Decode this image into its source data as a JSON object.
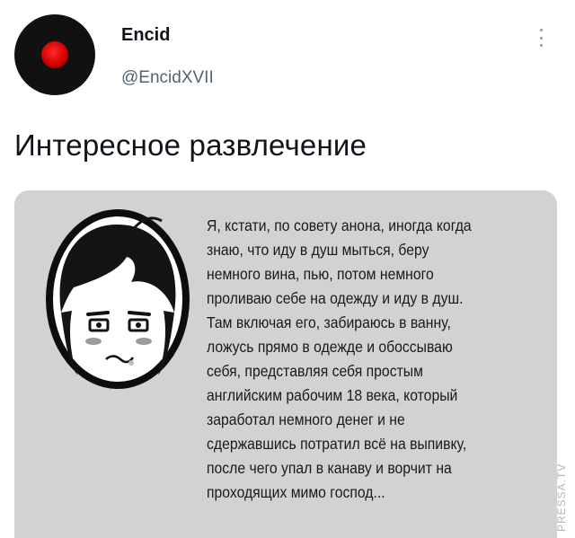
{
  "author": {
    "display_name": "Encid",
    "handle": "@EncidXVII",
    "avatar_icon": "red-dot-avatar",
    "avatar_bg": "#111111",
    "avatar_accent": "#d10000"
  },
  "menu": {
    "icon": "more-vertical-icon"
  },
  "tweet": {
    "text": "Интересное развлечение"
  },
  "media": {
    "caption_lines": [
      "Я, кстати, по совету анона, иногда когда",
      "знаю, что иду в душ мыться, беру",
      "немного вина, пью, потом немного",
      "проливаю себе на одежду и иду в душ.",
      "Там включая его, забираюсь в ванну,",
      "ложусь прямо в одежде и обоссываю",
      "себя, представляя себя простым",
      "английским рабочим 18 века, который",
      "заработал немного денег и не",
      "сдержавшись потратил всё на выпивку,",
      "после чего упал в канаву и ворчит на",
      "проходящих мимо господ..."
    ]
  },
  "watermark": "PRESSA.TV"
}
